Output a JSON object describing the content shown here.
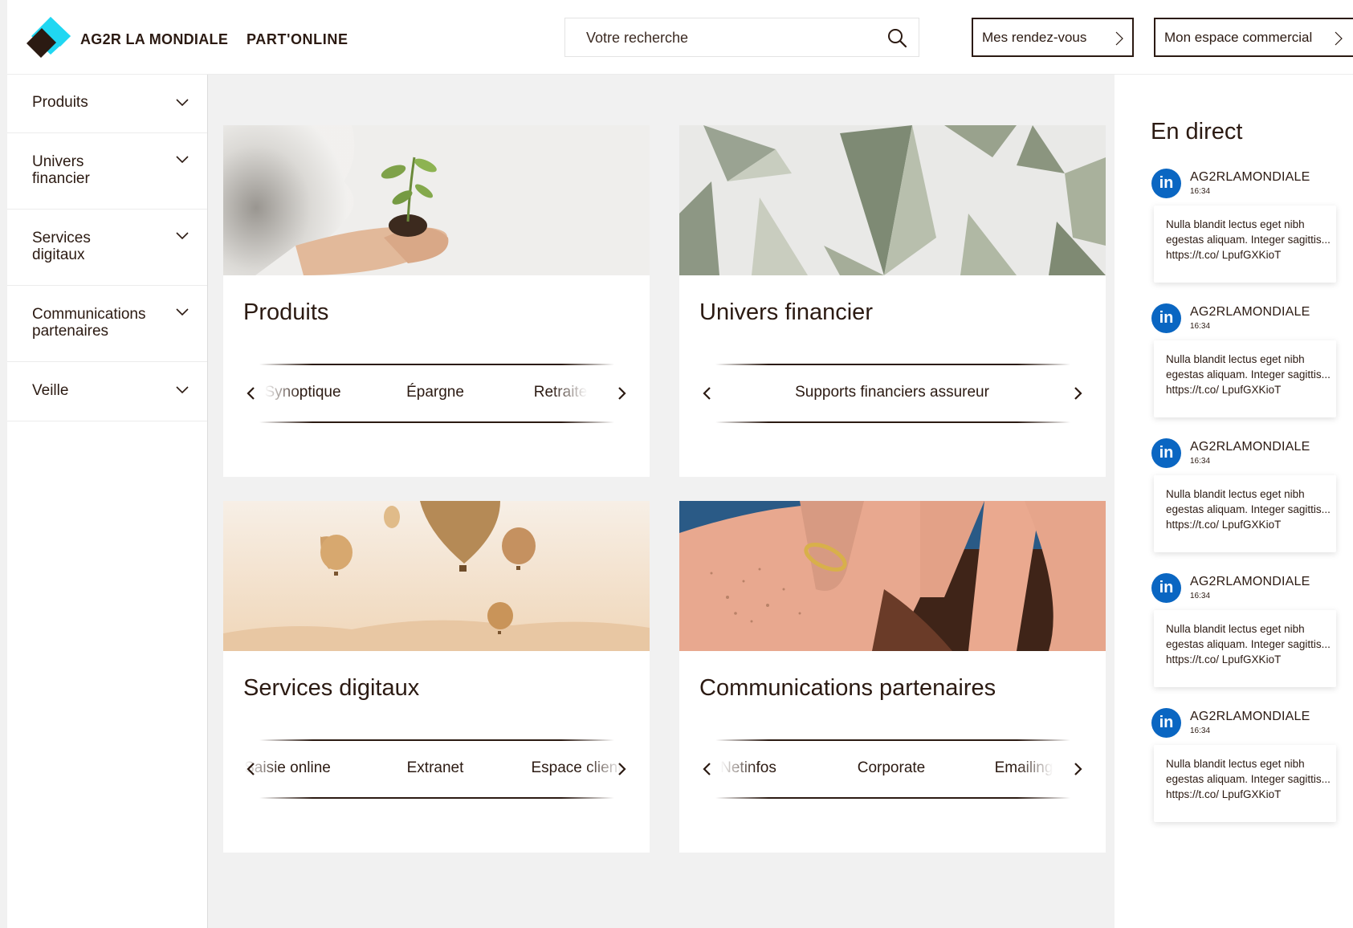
{
  "header": {
    "brand": "AG2R LA MONDIALE",
    "product": "PART'ONLINE",
    "search_placeholder": "Votre recherche",
    "buttons": {
      "rdv": "Mes rendez-vous",
      "espace": "Mon espace commercial"
    }
  },
  "sidebar": {
    "items": [
      {
        "label": "Produits"
      },
      {
        "label": "Univers\nfinancier"
      },
      {
        "label": "Services\ndigitaux"
      },
      {
        "label": "Communications\npartenaires"
      },
      {
        "label": "Veille"
      }
    ]
  },
  "cards": [
    {
      "title": "Produits",
      "items": [
        "Synoptique",
        "Épargne",
        "Retraite"
      ]
    },
    {
      "title": "Univers financier",
      "items": [
        "Supports financiers assureur"
      ]
    },
    {
      "title": "Services digitaux",
      "items": [
        "Saisie online",
        "Extranet",
        "Espace client"
      ]
    },
    {
      "title": "Communications partenaires",
      "items": [
        "Netinfos",
        "Corporate",
        "Emailing"
      ]
    }
  ],
  "live": {
    "title": "En direct",
    "posts": [
      {
        "author": "AG2RLAMONDIALE",
        "time": "16:34",
        "text": "Nulla blandit lectus eget nibh egestas aliquam. Integer sagittis... https://t.co/ LpufGXKioT"
      },
      {
        "author": "AG2RLAMONDIALE",
        "time": "16:34",
        "text": "Nulla blandit lectus eget nibh egestas aliquam. Integer sagittis... https://t.co/ LpufGXKioT"
      },
      {
        "author": "AG2RLAMONDIALE",
        "time": "16:34",
        "text": "Nulla blandit lectus eget nibh egestas aliquam. Integer sagittis... https://t.co/ LpufGXKioT"
      },
      {
        "author": "AG2RLAMONDIALE",
        "time": "16:34",
        "text": "Nulla blandit lectus eget nibh egestas aliquam. Integer sagittis... https://t.co/ LpufGXKioT"
      },
      {
        "author": "AG2RLAMONDIALE",
        "time": "16:34",
        "text": "Nulla blandit lectus eget nibh egestas aliquam. Integer sagittis... https://t.co/ LpufGXKioT"
      }
    ]
  },
  "colors": {
    "text": "#2b1a12",
    "accent_cyan": "#20d7f2",
    "linkedin": "#0a66c2",
    "background": "#f1f1f1"
  },
  "icons": {
    "search": "search-icon",
    "chevron_down": "chevron-down-icon",
    "chevron_right": "chevron-right-icon",
    "linkedin": "linkedin-icon"
  }
}
